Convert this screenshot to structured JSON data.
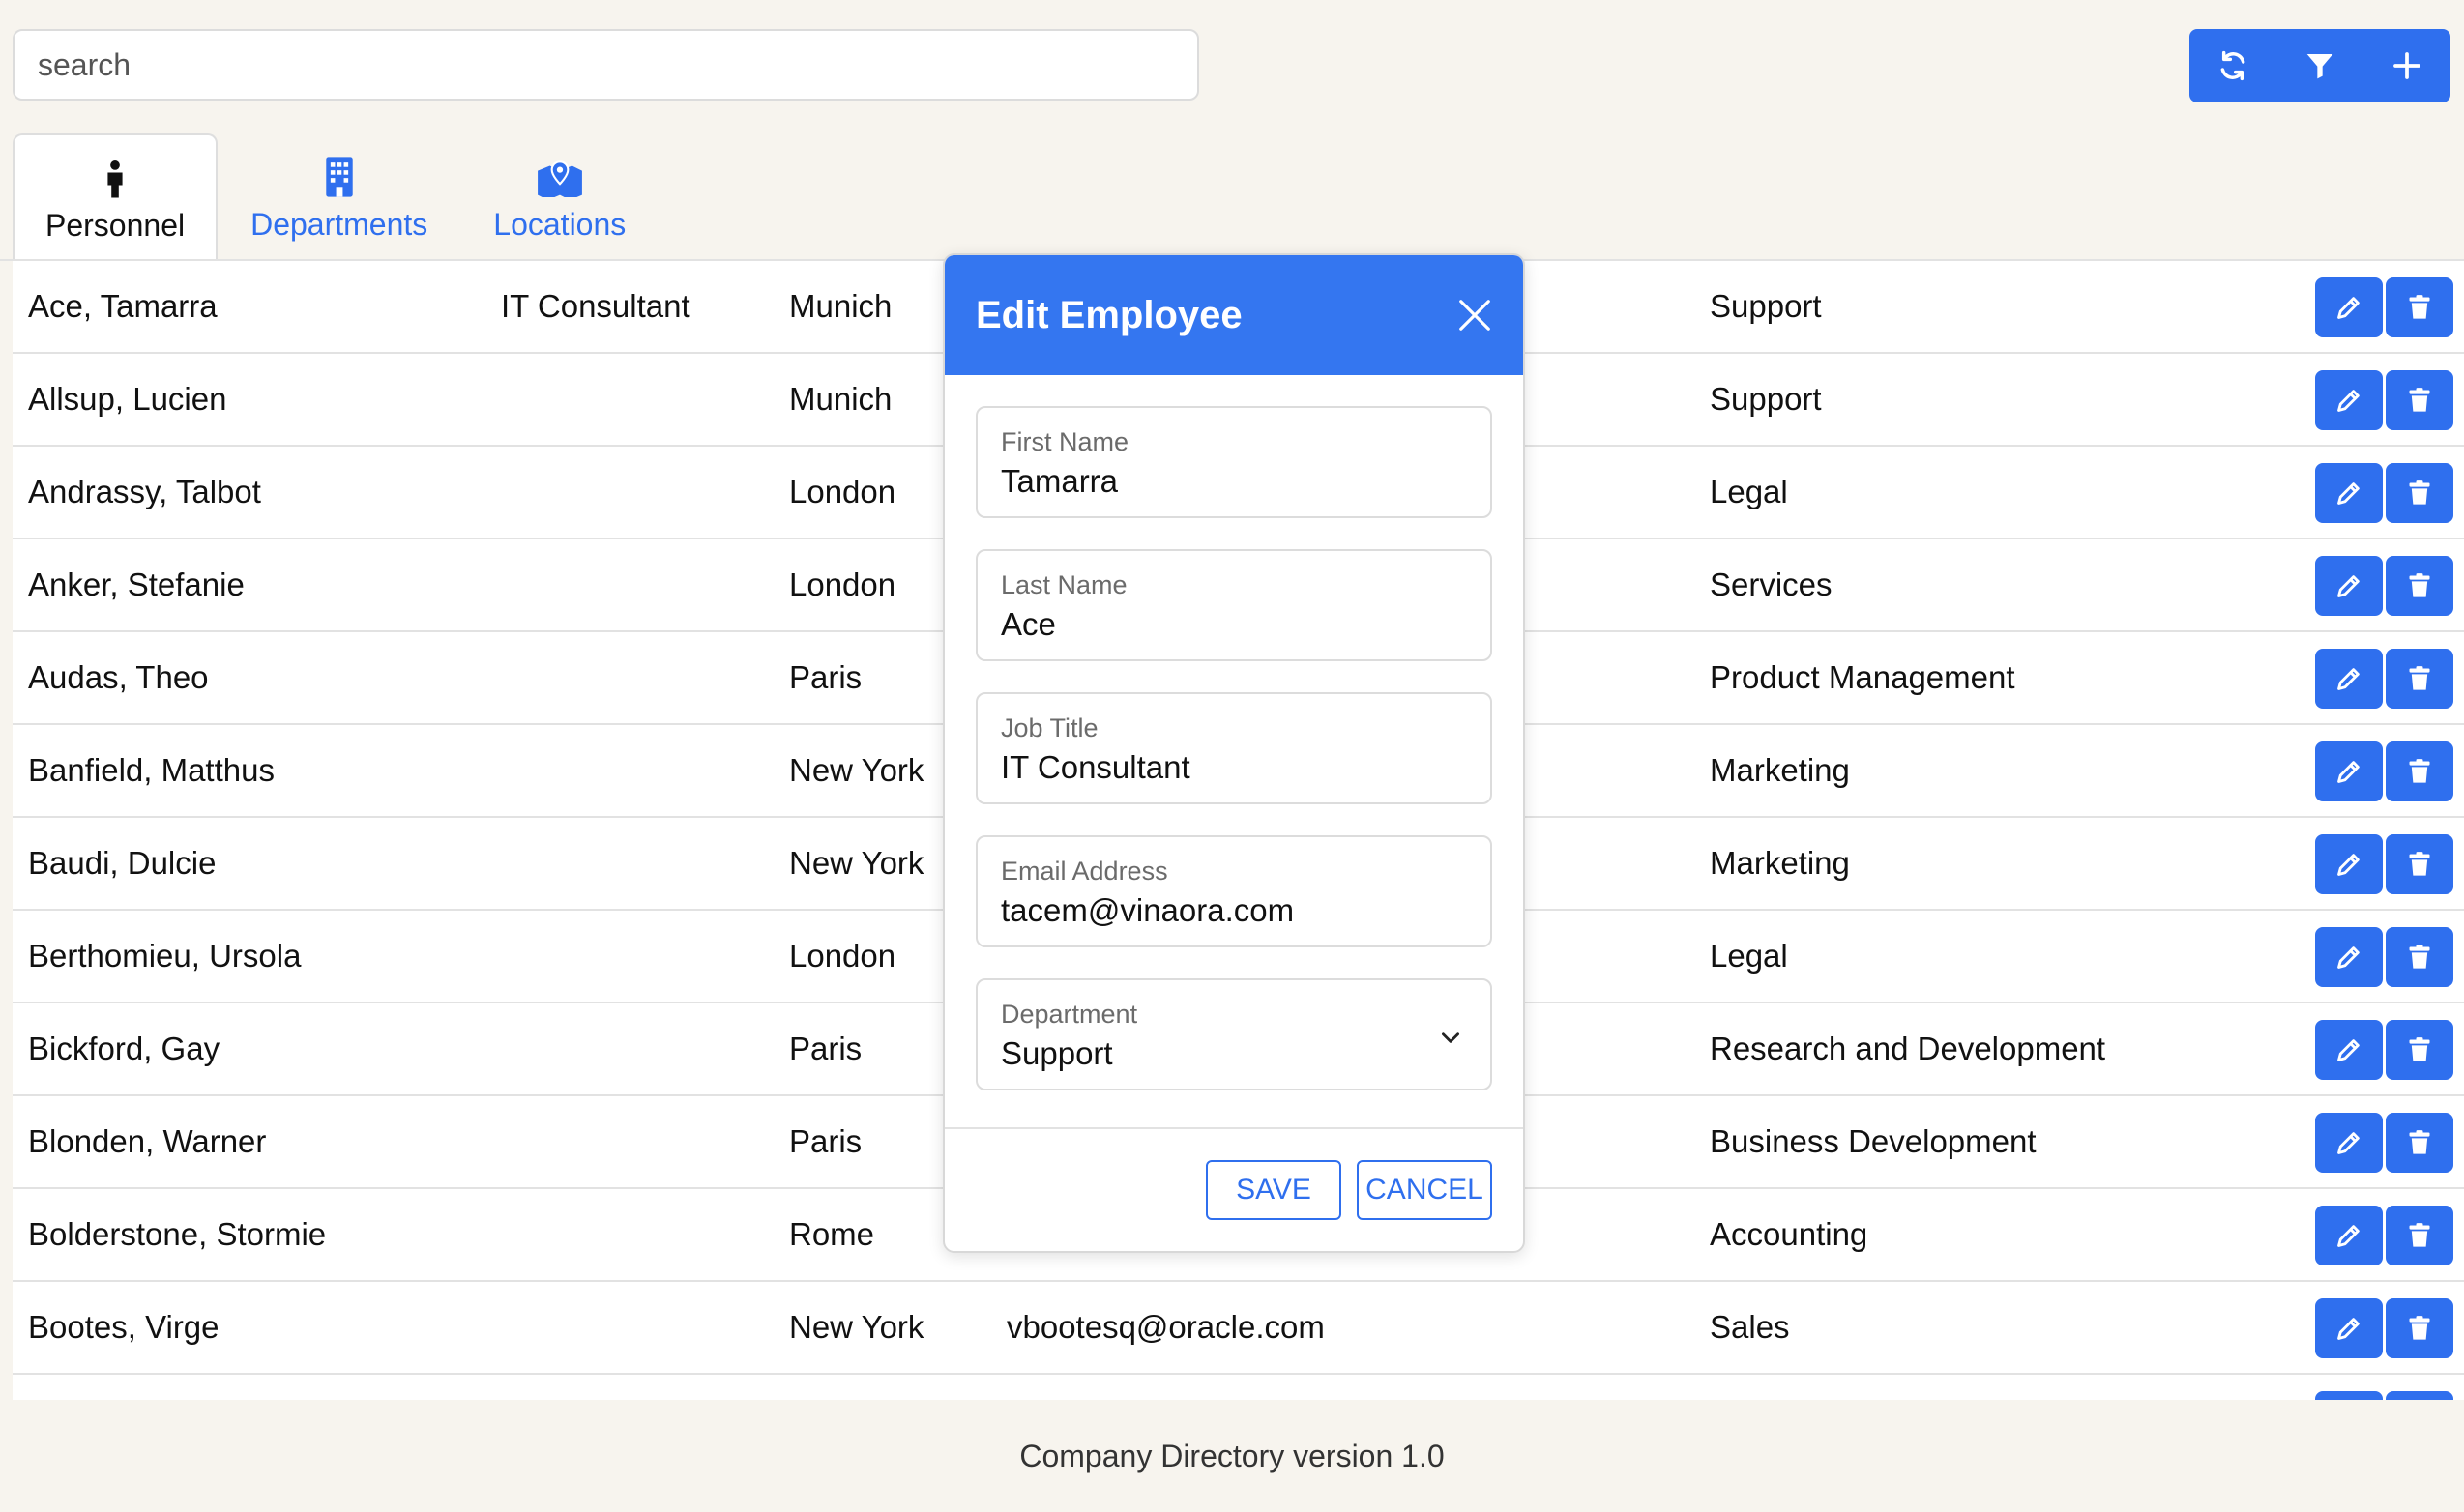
{
  "search": {
    "placeholder": "search"
  },
  "toolbar": {
    "refresh_icon": "refresh-icon",
    "filter_icon": "filter-icon",
    "add_icon": "plus-icon"
  },
  "tabs": [
    {
      "label": "Personnel",
      "icon": "person-icon",
      "active": true
    },
    {
      "label": "Departments",
      "icon": "building-icon",
      "active": false
    },
    {
      "label": "Locations",
      "icon": "map-icon",
      "active": false
    }
  ],
  "rows": [
    {
      "name": "Ace, Tamarra",
      "job": "IT Consultant",
      "location": "Munich",
      "email": "",
      "department": "Support"
    },
    {
      "name": "Allsup, Lucien",
      "job": "",
      "location": "Munich",
      "email": "",
      "department": "Support"
    },
    {
      "name": "Andrassy, Talbot",
      "job": "",
      "location": "London",
      "email": "",
      "department": "Legal"
    },
    {
      "name": "Anker, Stefanie",
      "job": "",
      "location": "London",
      "email": "",
      "department": "Services"
    },
    {
      "name": "Audas, Theo",
      "job": "",
      "location": "Paris",
      "email": "",
      "department": "Product Management"
    },
    {
      "name": "Banfield, Matthus",
      "job": "",
      "location": "New York",
      "email": "",
      "department": "Marketing"
    },
    {
      "name": "Baudi, Dulcie",
      "job": "",
      "location": "New York",
      "email": "",
      "department": "Marketing"
    },
    {
      "name": "Berthomieu, Ursola",
      "job": "",
      "location": "London",
      "email": "",
      "department": "Legal"
    },
    {
      "name": "Bickford, Gay",
      "job": "",
      "location": "Paris",
      "email": "",
      "department": "Research and Development"
    },
    {
      "name": "Blonden, Warner",
      "job": "",
      "location": "Paris",
      "email": "",
      "department": "Business Development"
    },
    {
      "name": "Bolderstone, Stormie",
      "job": "",
      "location": "Rome",
      "email": "",
      "department": "Accounting"
    },
    {
      "name": "Bootes, Virge",
      "job": "",
      "location": "New York",
      "email": "vbootesq@oracle.com",
      "department": "Sales"
    }
  ],
  "modal": {
    "title": "Edit Employee",
    "fields": {
      "first_name": {
        "label": "First Name",
        "value": "Tamarra"
      },
      "last_name": {
        "label": "Last Name",
        "value": "Ace"
      },
      "job_title": {
        "label": "Job Title",
        "value": "IT Consultant"
      },
      "email": {
        "label": "Email Address",
        "value": "tacem@vinaora.com"
      },
      "department": {
        "label": "Department",
        "value": "Support"
      }
    },
    "save_label": "SAVE",
    "cancel_label": "CANCEL"
  },
  "footer": {
    "text": "Company Directory version 1.0"
  },
  "colors": {
    "accent": "#2f6fee",
    "header": "#3476f0",
    "background": "#f7f4ee"
  }
}
